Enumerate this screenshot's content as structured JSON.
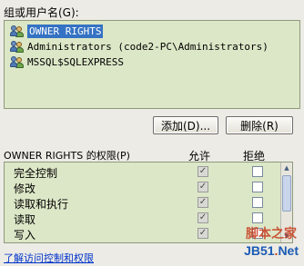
{
  "groups_label": "组或用户名(G):",
  "users": [
    {
      "name": "OWNER RIGHTS",
      "selected": true,
      "icon": "users-group-icon"
    },
    {
      "name": "Administrators (code2-PC\\Administrators)",
      "selected": false,
      "icon": "users-group-icon"
    },
    {
      "name": "MSSQL$SQLEXPRESS",
      "selected": false,
      "icon": "users-group-icon"
    }
  ],
  "buttons": {
    "add": "添加(D)...",
    "remove": "删除(R)"
  },
  "permissions": {
    "title": "OWNER RIGHTS 的权限(P)",
    "allow_header": "允许",
    "deny_header": "拒绝",
    "rows": [
      {
        "name": "完全控制",
        "allow": true,
        "deny": false
      },
      {
        "name": "修改",
        "allow": true,
        "deny": false
      },
      {
        "name": "读取和执行",
        "allow": true,
        "deny": false
      },
      {
        "name": "读取",
        "allow": true,
        "deny": false
      },
      {
        "name": "写入",
        "allow": true,
        "deny": false
      }
    ]
  },
  "help_link": "了解访问控制和权限",
  "watermark": {
    "line1": "脚本之家",
    "line2_a": "JB51",
    "line2_dot": ".",
    "line2_b": "Net"
  }
}
